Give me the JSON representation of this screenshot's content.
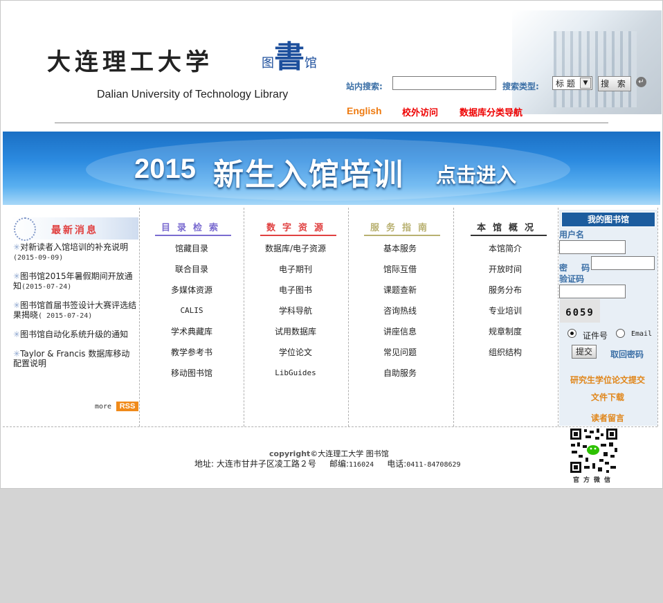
{
  "header": {
    "logo_cn": "大连理工大学",
    "logo_library_small": "图",
    "logo_library_big": "書",
    "logo_library_tail": "馆",
    "logo_en": "Dalian University of Technology Library",
    "search_label": "站内搜索:",
    "search_value": "",
    "type_label": "搜索类型:",
    "type_selected": "标 题",
    "search_button": "搜 索",
    "links": [
      "English",
      "校外访问",
      "数据库分类导航"
    ]
  },
  "banner": {
    "year": "2015",
    "title": "新生入馆培训",
    "cta": "点击进入"
  },
  "news": {
    "heading": "最新消息",
    "items": [
      {
        "text": "对新读者入馆培训的补充说明",
        "date": "(2015-09-09)"
      },
      {
        "text": "图书馆2015年暑假期间开放通知",
        "date": "(2015-07-24)"
      },
      {
        "text": "图书馆首届书签设计大赛评选结果揭晓",
        "date": "( 2015-07-24)"
      },
      {
        "text": "图书馆自动化系统升级的通知",
        "date": ""
      },
      {
        "text": "Taylor & Francis 数据库移动配置说明",
        "date": ""
      }
    ],
    "more": "more",
    "rss": "RSS"
  },
  "columns": [
    {
      "heading": "目录检索",
      "color": "#7a6bd0",
      "items": [
        "馆藏目录",
        "联合目录",
        "多媒体资源",
        "CALIS",
        "学术典藏库",
        "教学参考书",
        "移动图书馆"
      ]
    },
    {
      "heading": "数字资源",
      "color": "#e04040",
      "items": [
        "数据库/电子资源",
        "电子期刊",
        "电子图书",
        "学科导航",
        "试用数据库",
        "学位论文",
        "LibGuides"
      ]
    },
    {
      "heading": "服务指南",
      "color": "#b8b070",
      "items": [
        "基本服务",
        "馆际互借",
        "课题查新",
        "咨询热线",
        "讲座信息",
        "常见问题",
        "自助服务"
      ]
    },
    {
      "heading": "本馆概况",
      "color": "#333333",
      "items": [
        "本馆简介",
        "开放时间",
        "服务分布",
        "专业培训",
        "规章制度",
        "组织结构"
      ]
    }
  ],
  "mylib": {
    "title": "我的图书馆",
    "username_label": "用户名",
    "password_label": "密 码",
    "captcha_label": "验证码",
    "captcha_text": "6059",
    "radio_options": [
      "证件号",
      "Email"
    ],
    "radio_selected": "证件号",
    "submit": "提交",
    "forgot": "取回密码",
    "links": [
      "研究生学位论文提交",
      "文件下载",
      "读者留言"
    ]
  },
  "footer": {
    "copyright_prefix": "copyright©",
    "copyright_name": "大连理工大学 图书馆",
    "address_label": "地址:",
    "address": "大连市甘井子区凌工路２号",
    "zip_label": "邮编:",
    "zip": "116024",
    "phone_label": "电话:",
    "phone": "0411-84708629",
    "qr_caption": "官方微信"
  }
}
